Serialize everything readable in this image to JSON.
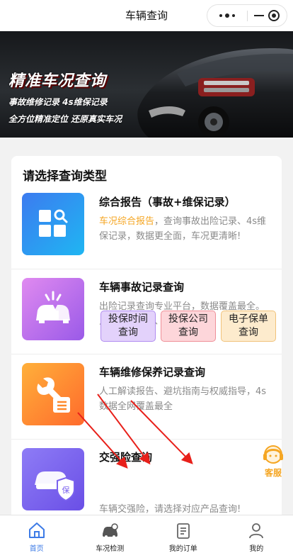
{
  "nav": {
    "title": "车辆查询"
  },
  "banner": {
    "title": "精准车况查询",
    "line1": "事故维修记录 4s维保记录",
    "line2": "全方位精准定位 还原真实车况"
  },
  "card": {
    "title": "请选择查询类型",
    "items": [
      {
        "name": "综合报告（事故+维保记录）",
        "highlight": "车况综合报告",
        "desc": "，查询事故出险记录、4s维保记录，数据更全面，车况更清晰!",
        "icon": "grid-search-icon",
        "color_from": "#3c7bf0",
        "color_to": "#1fb6f2"
      },
      {
        "name": "车辆事故记录查询",
        "desc": "出险记录查询专业平台，数据覆盖最全。人工解读报告、权威指导",
        "icon": "car-crash-icon",
        "color_from": "#e08af0",
        "color_to": "#9a5ae8"
      },
      {
        "name": "车辆维修保养记录查询",
        "desc": "人工解读报告、避坑指南与权威指导，4s数据全网覆盖最全",
        "icon": "wrench-list-icon",
        "color_from": "#ffb03a",
        "color_to": "#ff6a2c"
      },
      {
        "name": "交强险查询",
        "desc": "车辆交强险，请选择对应产品查询!",
        "icon": "car-insurance-icon",
        "color_from": "#8e7cf6",
        "color_to": "#6a4fe6"
      }
    ],
    "insurance_buttons": [
      {
        "label": "投保时间查询",
        "bg": "#e3d2fb",
        "border": "#b08cf0"
      },
      {
        "label": "投保公司查询",
        "bg": "#fdd6da",
        "border": "#ef8f98"
      },
      {
        "label": "电子保单查询",
        "bg": "#fdebcd",
        "border": "#f1c27a"
      }
    ]
  },
  "service": {
    "label": "客服",
    "icon": "headset-icon"
  },
  "tabbar": [
    {
      "label": "首页",
      "icon": "home-icon",
      "active": true
    },
    {
      "label": "车况检测",
      "icon": "car-check-icon",
      "active": false
    },
    {
      "label": "我的订单",
      "icon": "order-icon",
      "active": false
    },
    {
      "label": "我的",
      "icon": "user-icon",
      "active": false
    }
  ],
  "colors": {
    "accent": "#3d7be6",
    "highlight": "#f5a623",
    "arrow": "#e8201a"
  }
}
